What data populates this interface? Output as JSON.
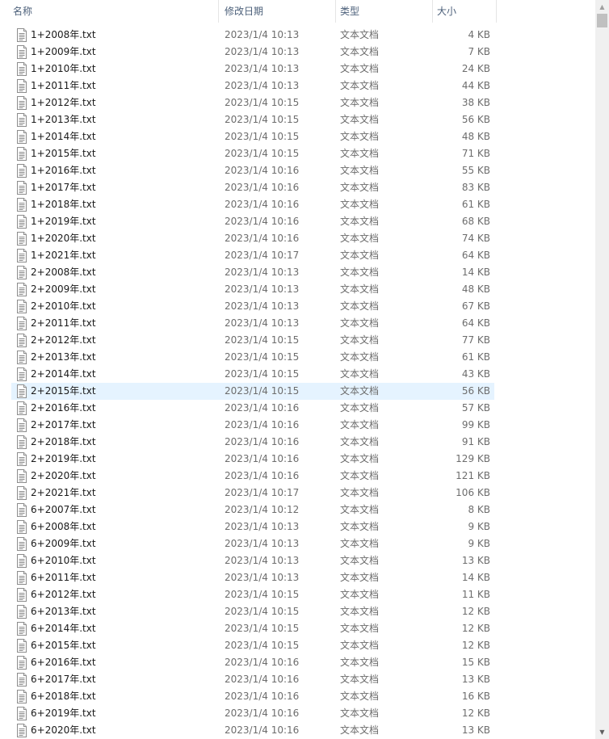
{
  "header": {
    "name": "名称",
    "date_modified": "修改日期",
    "type": "类型",
    "size": "大小"
  },
  "sort_indicator": "˄",
  "scrollbar": {
    "up_arrow": "▲",
    "down_arrow": "▼"
  },
  "selected_index": 21,
  "files": [
    {
      "name": "1+2008年.txt",
      "date": "2023/1/4 10:13",
      "type": "文本文档",
      "size": "4 KB"
    },
    {
      "name": "1+2009年.txt",
      "date": "2023/1/4 10:13",
      "type": "文本文档",
      "size": "7 KB"
    },
    {
      "name": "1+2010年.txt",
      "date": "2023/1/4 10:13",
      "type": "文本文档",
      "size": "24 KB"
    },
    {
      "name": "1+2011年.txt",
      "date": "2023/1/4 10:13",
      "type": "文本文档",
      "size": "44 KB"
    },
    {
      "name": "1+2012年.txt",
      "date": "2023/1/4 10:15",
      "type": "文本文档",
      "size": "38 KB"
    },
    {
      "name": "1+2013年.txt",
      "date": "2023/1/4 10:15",
      "type": "文本文档",
      "size": "56 KB"
    },
    {
      "name": "1+2014年.txt",
      "date": "2023/1/4 10:15",
      "type": "文本文档",
      "size": "48 KB"
    },
    {
      "name": "1+2015年.txt",
      "date": "2023/1/4 10:15",
      "type": "文本文档",
      "size": "71 KB"
    },
    {
      "name": "1+2016年.txt",
      "date": "2023/1/4 10:16",
      "type": "文本文档",
      "size": "55 KB"
    },
    {
      "name": "1+2017年.txt",
      "date": "2023/1/4 10:16",
      "type": "文本文档",
      "size": "83 KB"
    },
    {
      "name": "1+2018年.txt",
      "date": "2023/1/4 10:16",
      "type": "文本文档",
      "size": "61 KB"
    },
    {
      "name": "1+2019年.txt",
      "date": "2023/1/4 10:16",
      "type": "文本文档",
      "size": "68 KB"
    },
    {
      "name": "1+2020年.txt",
      "date": "2023/1/4 10:16",
      "type": "文本文档",
      "size": "74 KB"
    },
    {
      "name": "1+2021年.txt",
      "date": "2023/1/4 10:17",
      "type": "文本文档",
      "size": "64 KB"
    },
    {
      "name": "2+2008年.txt",
      "date": "2023/1/4 10:13",
      "type": "文本文档",
      "size": "14 KB"
    },
    {
      "name": "2+2009年.txt",
      "date": "2023/1/4 10:13",
      "type": "文本文档",
      "size": "48 KB"
    },
    {
      "name": "2+2010年.txt",
      "date": "2023/1/4 10:13",
      "type": "文本文档",
      "size": "67 KB"
    },
    {
      "name": "2+2011年.txt",
      "date": "2023/1/4 10:13",
      "type": "文本文档",
      "size": "64 KB"
    },
    {
      "name": "2+2012年.txt",
      "date": "2023/1/4 10:15",
      "type": "文本文档",
      "size": "77 KB"
    },
    {
      "name": "2+2013年.txt",
      "date": "2023/1/4 10:15",
      "type": "文本文档",
      "size": "61 KB"
    },
    {
      "name": "2+2014年.txt",
      "date": "2023/1/4 10:15",
      "type": "文本文档",
      "size": "43 KB"
    },
    {
      "name": "2+2015年.txt",
      "date": "2023/1/4 10:15",
      "type": "文本文档",
      "size": "56 KB"
    },
    {
      "name": "2+2016年.txt",
      "date": "2023/1/4 10:16",
      "type": "文本文档",
      "size": "57 KB"
    },
    {
      "name": "2+2017年.txt",
      "date": "2023/1/4 10:16",
      "type": "文本文档",
      "size": "99 KB"
    },
    {
      "name": "2+2018年.txt",
      "date": "2023/1/4 10:16",
      "type": "文本文档",
      "size": "91 KB"
    },
    {
      "name": "2+2019年.txt",
      "date": "2023/1/4 10:16",
      "type": "文本文档",
      "size": "129 KB"
    },
    {
      "name": "2+2020年.txt",
      "date": "2023/1/4 10:16",
      "type": "文本文档",
      "size": "121 KB"
    },
    {
      "name": "2+2021年.txt",
      "date": "2023/1/4 10:17",
      "type": "文本文档",
      "size": "106 KB"
    },
    {
      "name": "6+2007年.txt",
      "date": "2023/1/4 10:12",
      "type": "文本文档",
      "size": "8 KB"
    },
    {
      "name": "6+2008年.txt",
      "date": "2023/1/4 10:13",
      "type": "文本文档",
      "size": "9 KB"
    },
    {
      "name": "6+2009年.txt",
      "date": "2023/1/4 10:13",
      "type": "文本文档",
      "size": "9 KB"
    },
    {
      "name": "6+2010年.txt",
      "date": "2023/1/4 10:13",
      "type": "文本文档",
      "size": "13 KB"
    },
    {
      "name": "6+2011年.txt",
      "date": "2023/1/4 10:13",
      "type": "文本文档",
      "size": "14 KB"
    },
    {
      "name": "6+2012年.txt",
      "date": "2023/1/4 10:15",
      "type": "文本文档",
      "size": "11 KB"
    },
    {
      "name": "6+2013年.txt",
      "date": "2023/1/4 10:15",
      "type": "文本文档",
      "size": "12 KB"
    },
    {
      "name": "6+2014年.txt",
      "date": "2023/1/4 10:15",
      "type": "文本文档",
      "size": "12 KB"
    },
    {
      "name": "6+2015年.txt",
      "date": "2023/1/4 10:15",
      "type": "文本文档",
      "size": "12 KB"
    },
    {
      "name": "6+2016年.txt",
      "date": "2023/1/4 10:16",
      "type": "文本文档",
      "size": "15 KB"
    },
    {
      "name": "6+2017年.txt",
      "date": "2023/1/4 10:16",
      "type": "文本文档",
      "size": "13 KB"
    },
    {
      "name": "6+2018年.txt",
      "date": "2023/1/4 10:16",
      "type": "文本文档",
      "size": "16 KB"
    },
    {
      "name": "6+2019年.txt",
      "date": "2023/1/4 10:16",
      "type": "文本文档",
      "size": "12 KB"
    },
    {
      "name": "6+2020年.txt",
      "date": "2023/1/4 10:16",
      "type": "文本文档",
      "size": "13 KB"
    }
  ]
}
